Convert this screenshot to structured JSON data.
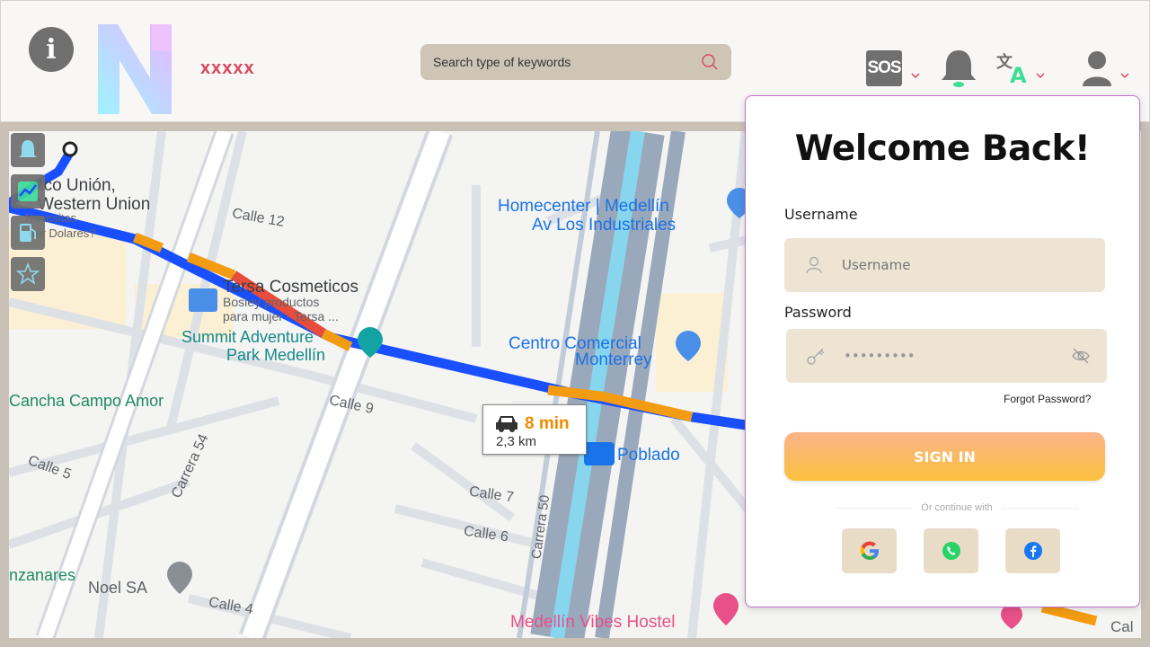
{
  "header": {
    "info_icon_text": "i",
    "brand": "xxxxx",
    "search": {
      "placeholder": "Search type of keywords"
    },
    "sos_label": "SOS",
    "icons": [
      "info-icon",
      "logo",
      "search-icon",
      "sos-icon",
      "bell-icon",
      "translate-icon",
      "user-icon",
      "chevron-down-icon"
    ]
  },
  "map": {
    "labels": {
      "banco": "nco Unión,",
      "western": "Western Union",
      "necesitas": "Necesitas",
      "dolares": "der Dolares?",
      "calle12": "Calle 12",
      "tersa": "Tersa Cosmeticos",
      "bosley": "Bosley productos",
      "mujer": "para mujer · Tersa ...",
      "summit1": "Summit Adventure",
      "summit2": "Park Medellín",
      "cancha": "Cancha Campo Amor",
      "calle9": "Calle 9",
      "calle5": "Calle 5",
      "carrera54": "Carrera 54",
      "homecenter1": "Homecenter | Medellín",
      "homecenter2": "Av Los Industriales",
      "centro1": "Centro Comercial",
      "centro2": "Monterrey",
      "poblado": "Poblado",
      "calle7": "Calle 7",
      "calle6": "Calle 6",
      "carrera50": "Carrera 50",
      "manzanares": "nzanares",
      "noel": "Noel SA",
      "calle4": "Calle 4",
      "vibes": "Medellín Vibes Hostel",
      "cal": "Cal"
    },
    "eta": {
      "time": "8 min",
      "distance": "2,3 km"
    },
    "side_tools": [
      "bell-icon",
      "chart-icon",
      "fuel-icon",
      "star-icon"
    ]
  },
  "login": {
    "title": "Welcome Back!",
    "username_label": "Username",
    "username_placeholder": "Username",
    "password_label": "Password",
    "password_value": "•••••••••",
    "forgot": "Forgot Password?",
    "signin": "SIGN IN",
    "or_continue": "Or continue with",
    "social": [
      "google-icon",
      "whatsapp-icon",
      "facebook-icon"
    ]
  },
  "colors": {
    "brand": "#d9455f",
    "route_blue": "#1a4fff",
    "route_orange": "#f39c12",
    "route_red": "#e74c3c",
    "panel_border": "#c070c8",
    "field_bg": "#ede4d4",
    "button_gradient_top": "#fbb48a",
    "button_gradient_bottom": "#fac03c"
  }
}
